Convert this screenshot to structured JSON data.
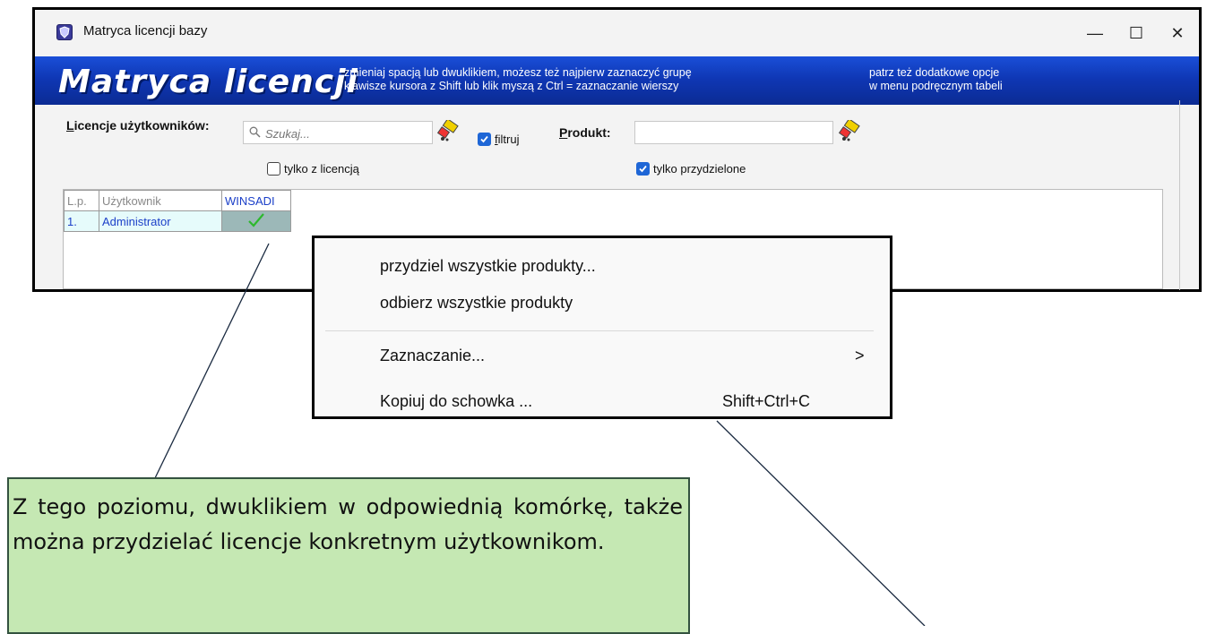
{
  "window": {
    "title": "Matryca licencji bazy",
    "minimize_glyph": "—",
    "maximize_glyph": "☐",
    "close_glyph": "✕"
  },
  "banner": {
    "title": "Matryca licencji",
    "hint1_line1": "zmieniaj spacją lub dwuklikiem, możesz też najpierw zaznaczyć grupę",
    "hint1_line2": "klawisze kursora z Shift lub klik myszą z Ctrl = zaznaczanie wierszy",
    "hint2_line1": "patrz też dodatkowe opcje",
    "hint2_line2": "w menu podręcznym tabeli"
  },
  "toolbar": {
    "users_label_first": "L",
    "users_label_rest": "icencje użytkowników:",
    "search_placeholder": "Szukaj...",
    "filter_label_first": "f",
    "filter_label_rest": "iltruj",
    "filter_checked": true,
    "product_label_first": "P",
    "product_label_rest": "rodukt:",
    "product_value": "",
    "only_licensed_label": "tylko z licencją",
    "only_licensed_checked": false,
    "only_assigned_label": "tylko przydzielone",
    "only_assigned_checked": true
  },
  "grid": {
    "headers": [
      "L.p.",
      "Użytkownik",
      "WINSADI"
    ],
    "rows": [
      {
        "lp": "1.",
        "user": "Administrator",
        "winsadi": "✓"
      }
    ]
  },
  "context_menu": {
    "items": [
      {
        "label": "przydziel wszystkie produkty..."
      },
      {
        "label": "odbierz wszystkie produkty"
      },
      {
        "label": "Zaznaczanie...",
        "submenu_glyph": ">"
      },
      {
        "label": "Kopiuj do schowka ...",
        "shortcut": "Shift+Ctrl+C"
      }
    ]
  },
  "callout": {
    "text": "Z tego poziomu, dwuklikiem w odpowiednią komórkę, także można przydzielać licencje konkretnym użytkownikom."
  },
  "colors": {
    "banner_blue": "#0f37b5",
    "checkbox_blue": "#1e66d6",
    "callout_green": "#c5e8b3",
    "checkmark_green": "#2db82d"
  }
}
